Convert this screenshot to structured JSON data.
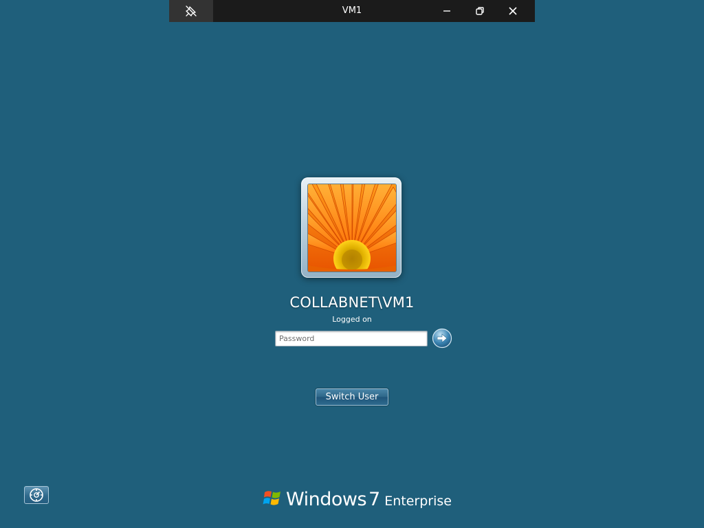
{
  "session_bar": {
    "title": "VM1",
    "pin_icon": "pin-off-icon",
    "minimize_icon": "minimize-icon",
    "restore_icon": "restore-icon",
    "close_icon": "close-icon",
    "colors": {
      "bar": "#1b1b1b",
      "pin_bg": "#333333"
    }
  },
  "logon": {
    "background_color": "#1f5f7b",
    "user_name": "COLLABNET\\VM1",
    "status": "Logged on",
    "password": {
      "value": "",
      "placeholder": "Password"
    },
    "submit_icon": "arrow-right-icon",
    "switch_user_label": "Switch User"
  },
  "footer": {
    "ease_of_access_icon": "ease-of-access-icon",
    "brand": {
      "word": "Windows",
      "version": "7",
      "edition": "Enterprise"
    }
  }
}
